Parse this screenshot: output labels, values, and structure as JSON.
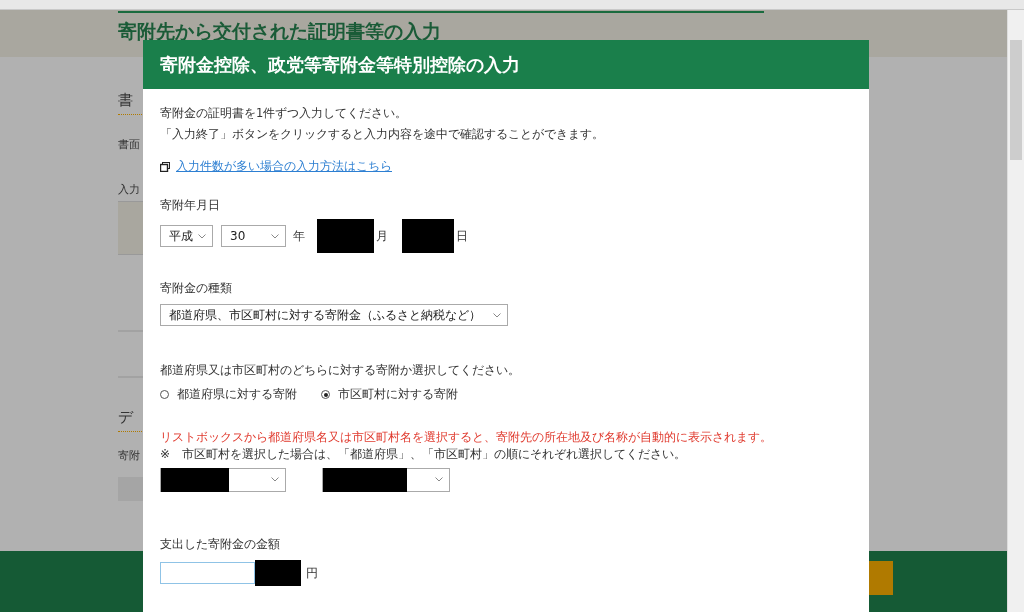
{
  "page": {
    "title": "寄附先から交付された証明書等の入力",
    "section_1": "書",
    "label_1": "書面",
    "label_2": "入力",
    "section_2": "デ",
    "label_3": "寄附"
  },
  "dialog": {
    "title": "寄附金控除、政党等寄附金等特別控除の入力",
    "intro": [
      "寄附金の証明書を1件ずつ入力してください。",
      "「入力終了」ボタンをクリックすると入力内容を途中で確認することができます。"
    ],
    "link": "入力件数が多い場合の入力方法はこちら",
    "date": {
      "label": "寄附年月日",
      "era": "平成",
      "year": "30",
      "year_unit": "年",
      "month_unit": "月",
      "day_unit": "日"
    },
    "type": {
      "label": "寄附金の種類",
      "value": "都道府県、市区町村に対する寄附金（ふるさと納税など）"
    },
    "recipient": {
      "prompt": "都道府県又は市区町村のどちらに対する寄附か選択してください。",
      "options": [
        {
          "label": "都道府県に対する寄附",
          "selected": false
        },
        {
          "label": "市区町村に対する寄附",
          "selected": true
        }
      ]
    },
    "notice": "リストボックスから都道府県名又は市区町村名を選択すると、寄附先の所在地及び名称が自動的に表示されます。",
    "note": "※　市区町村を選択した場合は、「都道府県」、「市区町村」の順にそれぞれ選択してください。",
    "amount": {
      "label": "支出した寄附金の金額",
      "unit": "円"
    }
  }
}
